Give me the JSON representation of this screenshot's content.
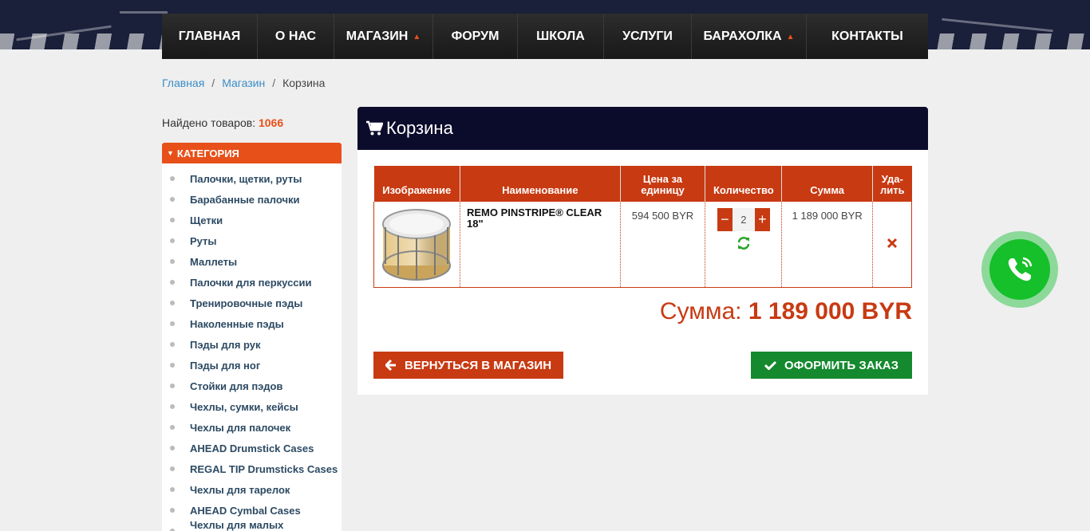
{
  "nav": {
    "items": [
      {
        "label": "ГЛАВНАЯ",
        "dropdown": false
      },
      {
        "label": "О НАС",
        "dropdown": false
      },
      {
        "label": "МАГАЗИН",
        "dropdown": true
      },
      {
        "label": "ФОРУМ",
        "dropdown": false
      },
      {
        "label": "ШКОЛА",
        "dropdown": false
      },
      {
        "label": "УСЛУГИ",
        "dropdown": false
      },
      {
        "label": "БАРАХОЛКА",
        "dropdown": true
      },
      {
        "label": "КОНТАКТЫ",
        "dropdown": false
      }
    ]
  },
  "breadcrumb": {
    "home": "Главная",
    "shop": "Магазин",
    "separator": "/",
    "current": "Корзина"
  },
  "sidebar": {
    "found_label": "Найдено товаров:",
    "found_count": "1066",
    "category_title": "КАТЕГОРИЯ",
    "categories": [
      "Палочки, щетки, руты",
      "Барабанные палочки",
      "Щетки",
      "Руты",
      "Маллеты",
      "Палочки для перкуссии",
      "Тренировочные пэды",
      "Наколенные пэды",
      "Пэды для рук",
      "Пэды для ног",
      "Стойки для пэдов",
      "Чехлы, сумки, кейсы",
      "Чехлы для палочек",
      "AHEAD Drumstick Cases",
      "REGAL TIP Drumsticks Cases",
      "Чехлы для тарелок",
      "AHEAD Cymbal Cases",
      "Чехлы для малых барабанов"
    ]
  },
  "cart": {
    "title": "Корзина",
    "columns": {
      "image": "Изображение",
      "name": "Наименование",
      "price_line1": "Цена за",
      "price_line2": "единицу",
      "qty": "Количество",
      "sum": "Сумма",
      "del_line1": "Уда-",
      "del_line2": "лить"
    },
    "items": [
      {
        "name": "REMO PINSTRIPE® CLEAR 18\"",
        "price": "594 500 BYR",
        "qty": "2",
        "sum": "1 189 000 BYR"
      }
    ],
    "total_label": "Сумма:",
    "total_value": "1 189 000 BYR",
    "back_button": "ВЕРНУТЬСЯ В МАГАЗИН",
    "order_button": "ОФОРМИТЬ ЗАКАЗ"
  },
  "colors": {
    "accent": "#c83a12",
    "orange": "#e8501a",
    "dark_header": "#0b0b2c",
    "green": "#14892e",
    "link": "#3b8dc7"
  }
}
